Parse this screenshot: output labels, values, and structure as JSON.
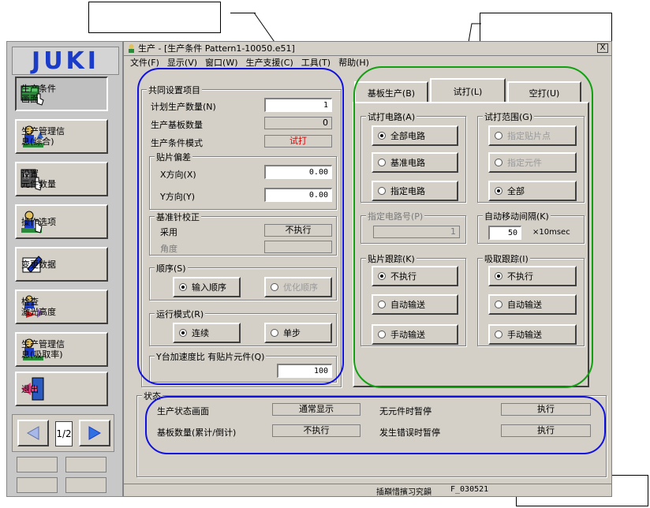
{
  "window": {
    "title": "生产 - [生产条件 Pattern1-10050.e51]",
    "close_glyph": "X"
  },
  "menu": [
    "文件(F)",
    "显示(V)",
    "窗口(W)",
    "生产支援(C)",
    "工具(T)",
    "帮助(H)"
  ],
  "logo": "JUKI",
  "side_buttons": [
    {
      "label": "生产条件\n画面",
      "icon": "production-condition-icon"
    },
    {
      "label": "生产管理信\n息(综合)",
      "icon": "production-management-icon"
    },
    {
      "label": "设置\n元件数量",
      "icon": "component-count-icon"
    },
    {
      "label": "操作选项",
      "icon": "operation-option-icon"
    },
    {
      "label": "变更数据",
      "icon": "edit-data-icon"
    },
    {
      "label": "检查\n激光高度",
      "icon": "laser-check-icon"
    },
    {
      "label": "生产管理信\n息(吸取率)",
      "icon": "pickup-rate-icon"
    },
    {
      "label": "退出",
      "icon": "exit-icon"
    }
  ],
  "nav": {
    "page": "1/2"
  },
  "common": {
    "title": "共同设置项目",
    "plan_label": "计划生产数量(N)",
    "plan_value": "1",
    "boards_label": "生产基板数量",
    "boards_value": "0",
    "mode_label": "生产条件模式",
    "mode_value": "试打",
    "offset_title": "贴片偏差",
    "x_label": "X方向(X)",
    "x_value": "0.00",
    "y_label": "Y方向(Y)",
    "y_value": "0.00",
    "ref_title": "基准针校正",
    "adopt_label": "采用",
    "adopt_value": "不执行",
    "angle_label": "角度",
    "order_title": "顺序(S)",
    "order_opt1": "输入顺序",
    "order_opt2": "优化顺序",
    "runmode_title": "运行模式(R)",
    "run_opt1": "连续",
    "run_opt2": "单步",
    "accel_title": "Y台加速度比 有贴片元件(Q)",
    "accel_value": "100"
  },
  "tabs": [
    "基板生产(B)",
    "试打(L)",
    "空打(U)"
  ],
  "trial": {
    "circuit_title": "试打电路(A)",
    "circuit_opts": [
      "全部电路",
      "基准电路",
      "指定电路"
    ],
    "range_title": "试打范围(G)",
    "range_opts": [
      "指定贴片点",
      "指定元件",
      "全部"
    ],
    "circuit_no_title": "指定电路号(P)",
    "circuit_no_value": "1",
    "interval_title": "自动移动间隔(K)",
    "interval_value": "50",
    "interval_unit": "×10msec",
    "track_title": "贴片跟踪(K)",
    "track_opts": [
      "不执行",
      "自动输送",
      "手动输送"
    ],
    "pick_title": "吸取跟踪(I)",
    "pick_opts": [
      "不执行",
      "自动输送",
      "手动输送"
    ]
  },
  "status": {
    "title": "状态",
    "screen_label": "生产状态画面",
    "screen_value": "通常显示",
    "nocomp_label": "无元件时暂停",
    "nocomp_value": "执行",
    "count_label": "基板数量(累计/倒计)",
    "count_value": "不执行",
    "err_label": "发生错误时暂停",
    "err_value": "执行"
  },
  "statusbar": {
    "text1": "插巔惜擯习究韻",
    "text2": "F_030521"
  },
  "colors": {
    "blue_ring": "#1010e0",
    "green_ring": "#10a010",
    "logo": "#1a3cc8",
    "warning_text": "#e00000"
  }
}
